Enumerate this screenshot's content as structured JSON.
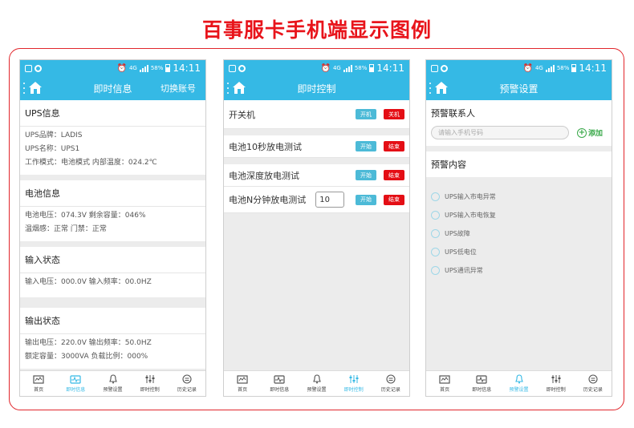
{
  "page_title": "百事服卡手机端显示图例",
  "status": {
    "network": "4G",
    "percent": "58%",
    "time": "14:11"
  },
  "screens": [
    {
      "title": "即时信息",
      "right": "切换账号",
      "sections": [
        {
          "title": "UPS信息",
          "lines": [
            "UPS品牌：LADIS",
            "UPS名称：UPS1",
            "工作模式：电池模式  内部温度：024.2℃"
          ]
        },
        {
          "title": "电池信息",
          "lines": [
            "电池电压：074.3V 剩余容量：046%",
            "温烟感：正常 门禁：正常"
          ]
        },
        {
          "title": "输入状态",
          "lines": [
            "输入电压：000.0V    输入频率：00.0HZ"
          ]
        },
        {
          "title": "输出状态",
          "lines": [
            "输出电压：220.0V  输出频率：50.0HZ",
            "额定容量：3000VA  负载比例：000%"
          ]
        }
      ]
    },
    {
      "title": "即时控制",
      "rows": [
        {
          "label": "开关机",
          "btn1": "开机",
          "btn2": "关机"
        },
        {
          "label": "电池10秒放电测试",
          "btn1": "开始",
          "btn2": "结束"
        },
        {
          "label": "电池深度放电测试",
          "btn1": "开始",
          "btn2": "结束"
        },
        {
          "label": "电池N分钟放电测试",
          "value": "10",
          "btn1": "开始",
          "btn2": "结束"
        }
      ]
    },
    {
      "title": "预警设置",
      "contact_title": "预警联系人",
      "input_placeholder": "请输入手机号码",
      "add_label": "添加",
      "content_title": "预警内容",
      "options": [
        "UPS输入市电异常",
        "UPS输入市电恢复",
        "UPS故障",
        "UPS低电位",
        "UPS通讯异常"
      ]
    }
  ],
  "tabs": [
    "首页",
    "即时信息",
    "预警设置",
    "即时控制",
    "历史记录"
  ],
  "active_tabs": [
    1,
    3,
    2
  ],
  "colors": {
    "accent": "#35b9e5",
    "red": "#e40e15",
    "title_red": "#e8141b"
  },
  "icons": [
    "home-icon",
    "chart-icon",
    "bell-icon",
    "sliders-icon",
    "history-icon"
  ]
}
